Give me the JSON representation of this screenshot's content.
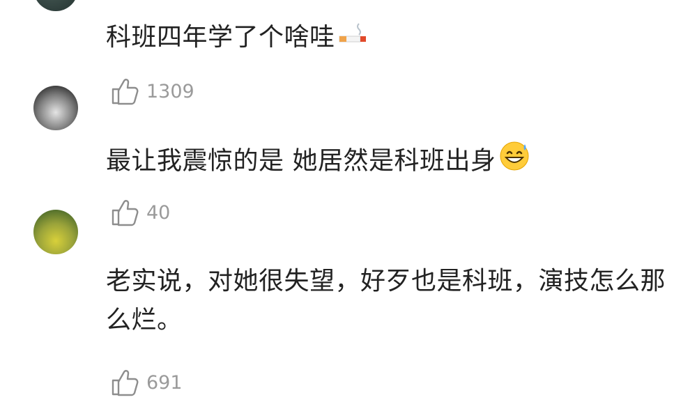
{
  "comments": [
    {
      "text": "科班四年学了个啥哇",
      "emoji": "cigarette-emoji",
      "likes": "1309"
    },
    {
      "text": "最让我震惊的是  她居然是科班出身",
      "emoji": "grinning-sweat-emoji",
      "likes": "40"
    },
    {
      "text": "老实说，对她很失望，好歹也是科班，演技怎么那么烂。",
      "likes": "691"
    }
  ],
  "icons": {
    "like": "thumbs-up-outline-icon"
  }
}
